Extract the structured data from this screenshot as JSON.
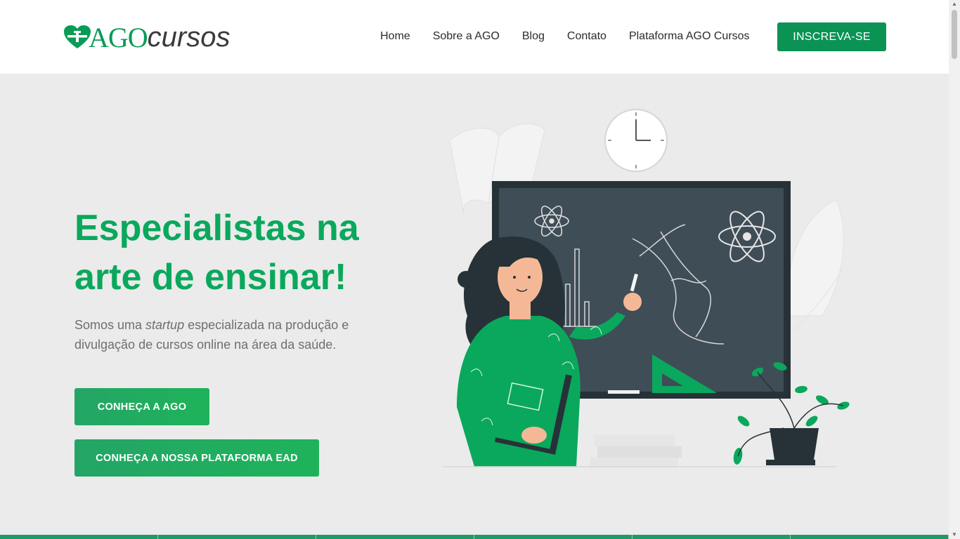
{
  "logo": {
    "brand_a": "AGO",
    "brand_b": "cursos"
  },
  "nav": {
    "items": [
      "Home",
      "Sobre a AGO",
      "Blog",
      "Contato",
      "Plataforma AGO Cursos"
    ],
    "cta": "INSCREVA-SE"
  },
  "hero": {
    "title_line1": "Especialistas na",
    "title_line2": "arte de ensinar!",
    "subtitle_pre": "Somos uma ",
    "subtitle_em": "startup",
    "subtitle_post": " especializada na produção e divulgação de cursos online na área da saúde.",
    "button_1": "CONHEÇA A AGO",
    "button_2": "CONHEÇA A NOSSA PLATAFORMA EAD"
  },
  "colors": {
    "brand_green": "#0a9355",
    "title_green": "#0aa85c",
    "chalkboard": "#36454f"
  },
  "icons": [
    "heart-cross-icon",
    "chevron-up-icon",
    "chevron-down-icon"
  ]
}
